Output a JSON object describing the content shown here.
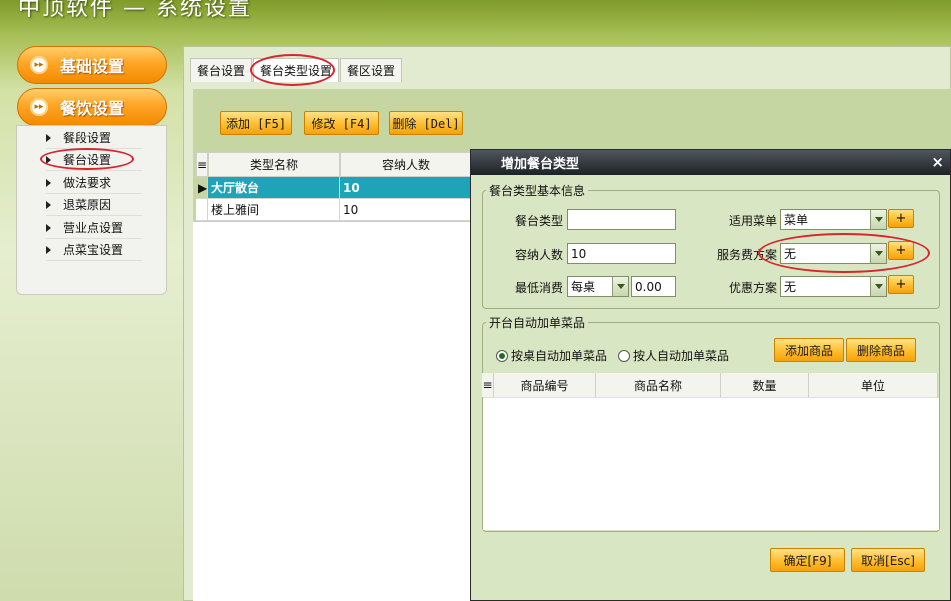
{
  "app": {
    "title": "中顶软件 — 系统设置"
  },
  "nav": {
    "sections": [
      {
        "label": "基础设置"
      },
      {
        "label": "餐饮设置"
      }
    ],
    "items": [
      {
        "label": "餐段设置"
      },
      {
        "label": "餐台设置"
      },
      {
        "label": "做法要求"
      },
      {
        "label": "退菜原因"
      },
      {
        "label": "营业点设置"
      },
      {
        "label": "点菜宝设置"
      }
    ]
  },
  "tabs": [
    {
      "label": "餐台设置"
    },
    {
      "label": "餐台类型设置"
    },
    {
      "label": "餐区设置"
    }
  ],
  "toolbar": {
    "add_label": "添加 [F5]",
    "edit_label": "修改 [F4]",
    "delete_label": "删除 [Del]"
  },
  "grid": {
    "columns": [
      "类型名称",
      "容纳人数"
    ],
    "rows": [
      {
        "name": "大厅散台",
        "capacity": "10"
      },
      {
        "name": "楼上雅间",
        "capacity": "10"
      }
    ]
  },
  "dialog": {
    "title": "增加餐台类型",
    "close": "×",
    "basic_group": "餐台类型基本信息",
    "fields": {
      "table_type_label": "餐台类型",
      "table_type_value": "",
      "capacity_label": "容纳人数",
      "capacity_value": "10",
      "min_spend_label": "最低消费",
      "min_spend_mode": "每桌",
      "min_spend_value": "0.00",
      "menu_label": "适用菜单",
      "menu_value": "菜单",
      "service_fee_label": "服务费方案",
      "service_fee_value": "无",
      "discount_label": "优惠方案",
      "discount_value": "无",
      "plus": "+"
    },
    "auto_group": "开台自动加单菜品",
    "radio_table": "按桌自动加单菜品",
    "radio_person": "按人自动加单菜品",
    "add_goods": "添加商品",
    "delete_goods": "删除商品",
    "goods_columns": [
      "商品编号",
      "商品名称",
      "数量",
      "单位"
    ],
    "confirm": "确定[F9]",
    "cancel": "取消[Esc]"
  }
}
